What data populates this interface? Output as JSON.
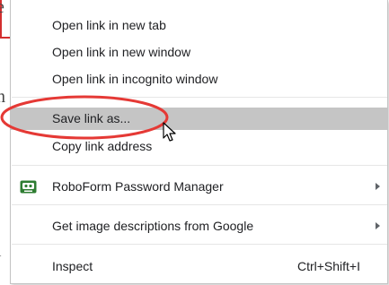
{
  "context_menu": {
    "items": [
      {
        "label": "Open link in new tab"
      },
      {
        "label": "Open link in new window"
      },
      {
        "label": "Open link in incognito window"
      },
      {
        "label": "Save link as..."
      },
      {
        "label": "Copy link address"
      },
      {
        "label": "RoboForm Password Manager"
      },
      {
        "label": "Get image descriptions from Google"
      },
      {
        "label": "Inspect",
        "shortcut": "Ctrl+Shift+I"
      }
    ],
    "highlighted_item": "Save link as...",
    "highlight_color": "#c5c5c5"
  },
  "background_fragments": [
    "e",
    "n",
    ":",
    "l"
  ],
  "annotation": {
    "shape": "ellipse",
    "color": "#e53935",
    "target": "Save link as..."
  },
  "icons": {
    "roboform": "roboform-icon",
    "submenu_arrow": "chevron-right-icon",
    "cursor": "mouse-pointer-icon"
  }
}
